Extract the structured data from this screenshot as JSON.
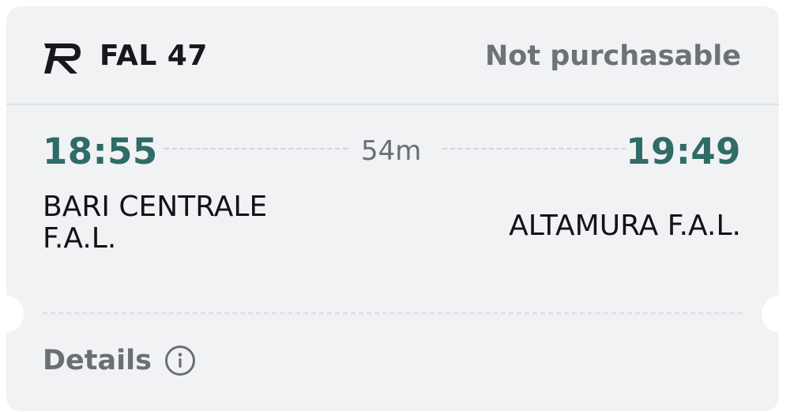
{
  "header": {
    "operator_icon": "fal-logo-icon",
    "train_name": "FAL 47",
    "status": "Not purchasable"
  },
  "journey": {
    "departure_time": "18:55",
    "arrival_time": "19:49",
    "duration": "54m",
    "departure_station": "BARI CENTRALE F.A.L.",
    "arrival_station": "ALTAMURA F.A.L."
  },
  "footer": {
    "details_label": "Details",
    "details_icon": "info-icon"
  },
  "colors": {
    "card_background": "#f1f2f4",
    "time_accent": "#2f6b67",
    "muted_text": "#6e7178",
    "primary_text": "#16181c"
  }
}
